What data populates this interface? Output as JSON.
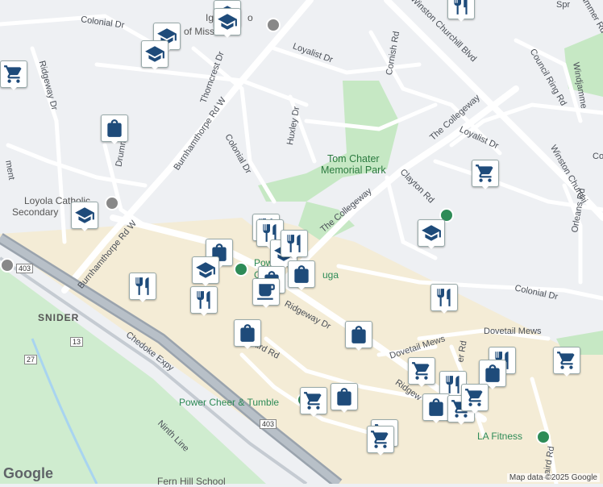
{
  "colors": {
    "background": "#eef0f3",
    "commercial": "#f4ecd6",
    "park": "#c6e8c4",
    "road": "#ffffff",
    "highway": "#9aa3ad",
    "marker_icon": "#1e4b7a",
    "poi_text": "#2e8b57"
  },
  "roads": [
    {
      "id": "colonial-dr-nw",
      "label": "Colonial Dr"
    },
    {
      "id": "ridgeway-dr-w",
      "label": "Ridgeway Dr"
    },
    {
      "id": "thorncrest-dr",
      "label": "Thorncrest Dr"
    },
    {
      "id": "burnhamthorpe-rd-w-upper",
      "label": "Burnhamthorpe Rd W"
    },
    {
      "id": "burnhamthorpe-rd-w-lower",
      "label": "Burnhamthorpe Rd W"
    },
    {
      "id": "drummond",
      "label": "Drummo"
    },
    {
      "id": "colonial-dr-mid",
      "label": "Colonial Dr"
    },
    {
      "id": "loyalist-dr-n",
      "label": "Loyalist Dr"
    },
    {
      "id": "cornish-rd",
      "label": "Cornish Rd"
    },
    {
      "id": "huxley-dr",
      "label": "Huxley Dr"
    },
    {
      "id": "winston-churchill-blvd",
      "label": "Winston Churchill Blvd"
    },
    {
      "id": "winston-churchill-blvd-e",
      "label": "Winston Churchi"
    },
    {
      "id": "council-ring-rd",
      "label": "Council Ring Rd"
    },
    {
      "id": "windjammer-rd",
      "label": "Windjammer Rd"
    },
    {
      "id": "windjammer-rd-2",
      "label": "Windjamme"
    },
    {
      "id": "the-collegeway-e",
      "label": "The Collegeway"
    },
    {
      "id": "the-collegeway-w",
      "label": "The Collegeway"
    },
    {
      "id": "loyalist-dr-e",
      "label": "Loyalist Dr"
    },
    {
      "id": "clayton-rd",
      "label": "Clayton Rd"
    },
    {
      "id": "orleans-rd",
      "label": "Orleans Rd"
    },
    {
      "id": "ridgeway-dr-mid",
      "label": "Ridgeway Dr"
    },
    {
      "id": "ridgeway-dr-se",
      "label": "Ridgew"
    },
    {
      "id": "colonial-dr-e",
      "label": "Colonial Dr"
    },
    {
      "id": "dovetail-mews-w",
      "label": "Dovetail Mews"
    },
    {
      "id": "dovetail-mews-e",
      "label": "Dovetail Mews"
    },
    {
      "id": "chedoke-expy",
      "label": "Chedoke Expy"
    },
    {
      "id": "ninth-line",
      "label": "Ninth Line"
    },
    {
      "id": "laird-rd",
      "label": "aird Rd"
    },
    {
      "id": "laird-rd-2",
      "label": "Laird Rd"
    },
    {
      "id": "ment",
      "label": "ment"
    },
    {
      "id": "spr",
      "label": "Spr"
    },
    {
      "id": "co",
      "label": "Co"
    },
    {
      "id": "er-rd",
      "label": "er Rd"
    }
  ],
  "shields": [
    {
      "id": "hwy-403-w",
      "label": "403"
    },
    {
      "id": "hwy-403-s",
      "label": "403"
    },
    {
      "id": "rd-13",
      "label": "13"
    },
    {
      "id": "rd-27",
      "label": "27"
    }
  ],
  "places": [
    {
      "id": "iglesia",
      "label": "Iglesia",
      "kind": "poi"
    },
    {
      "id": "of-mississauga",
      "label": "of Missi",
      "kind": "poi"
    },
    {
      "id": "auga",
      "label": "o"
    },
    {
      "id": "loyola",
      "label": "Loyola Catholic",
      "kind": "poi"
    },
    {
      "id": "secondary",
      "label": "Secondary",
      "kind": "poi"
    },
    {
      "id": "power",
      "label": "Pow",
      "kind": "poi"
    },
    {
      "id": "power-g",
      "label": "G",
      "kind": "poi"
    },
    {
      "id": "uga",
      "label": "uga",
      "kind": "poi"
    },
    {
      "id": "power-cheer",
      "label": "Power Cheer & Tumble",
      "kind": "poi"
    },
    {
      "id": "la-fitness",
      "label": "LA Fitness",
      "kind": "poi"
    },
    {
      "id": "fern-hill",
      "label": "Fern Hill School",
      "kind": "poi"
    },
    {
      "id": "snider",
      "label": "SNIDER",
      "kind": "area"
    }
  ],
  "park": {
    "line1": "Tom Chater",
    "line2": "Memorial Park"
  },
  "markers": [
    {
      "type": "school"
    },
    {
      "type": "school"
    },
    {
      "type": "school"
    },
    {
      "type": "restaurant"
    },
    {
      "type": "grocery"
    },
    {
      "type": "shopping"
    },
    {
      "type": "school"
    },
    {
      "type": "grocery"
    },
    {
      "type": "school"
    },
    {
      "type": "shopping"
    },
    {
      "type": "school"
    },
    {
      "type": "restaurant"
    },
    {
      "type": "restaurant"
    },
    {
      "type": "restaurant"
    },
    {
      "type": "restaurant"
    },
    {
      "type": "school"
    },
    {
      "type": "shopping"
    },
    {
      "type": "shopping"
    },
    {
      "type": "cafe"
    },
    {
      "type": "restaurant"
    },
    {
      "type": "shopping"
    },
    {
      "type": "shopping"
    },
    {
      "type": "restaurant"
    },
    {
      "type": "grocery"
    },
    {
      "type": "restaurant"
    },
    {
      "type": "grocery"
    },
    {
      "type": "restaurant"
    },
    {
      "type": "shopping"
    },
    {
      "type": "shopping"
    },
    {
      "type": "grocery"
    },
    {
      "type": "grocery"
    },
    {
      "type": "shopping"
    },
    {
      "type": "grocery"
    },
    {
      "type": "grocery"
    },
    {
      "type": "school"
    },
    {
      "type": "grocery"
    }
  ],
  "attribution": "Map data ©2025 Google",
  "logo": "Google"
}
